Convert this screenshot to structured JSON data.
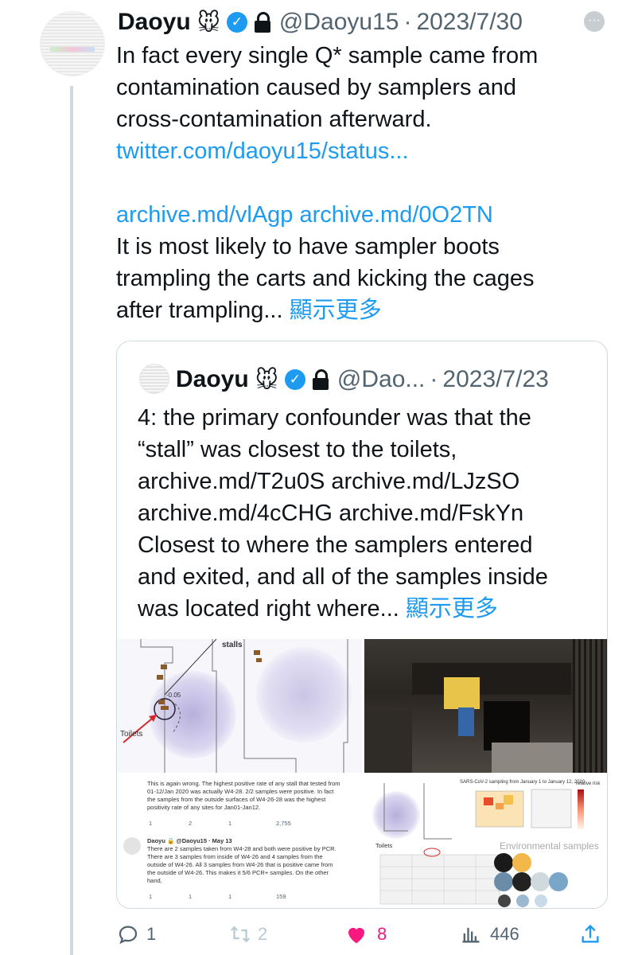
{
  "tweet": {
    "name": "Daoyu",
    "emoji": "🐭",
    "handle": "@Daoyu15",
    "separator": "·",
    "date": "2023/7/30",
    "more_label": "···",
    "lines": [
      "In fact every single Q* sample came from",
      "contamination caused by samplers and",
      "cross-contamination afterward."
    ],
    "link_status": "twitter.com/daoyu15/status...",
    "link_archive_1": "archive.md/vlAgp",
    "link_archive_2": "archive.md/0O2TN",
    "lines2": [
      "It is most likely to have sampler boots",
      "trampling the carts and kicking the cages"
    ],
    "last_line": "after trampling...",
    "show_more": "顯示更多"
  },
  "quote": {
    "name": "Daoyu",
    "emoji": "🐭",
    "handle": "@Dao...",
    "separator": "·",
    "date": "2023/7/23",
    "lines": [
      "4: the primary confounder was that the",
      "“stall” was closest to the toilets,",
      "archive.md/T2u0S archive.md/LJzSO",
      "archive.md/4cCHG archive.md/FskYn",
      "Closest to where the samplers entered",
      "and exited, and all of the samples inside"
    ],
    "last_line": "was located right where...",
    "show_more": "顯示更多",
    "media": {
      "map_label_stalls": "stalls",
      "map_label_toilets": "Toilets",
      "map_label_value": "-0.05",
      "embedded_tweet_text": [
        "This is again wrong. The highest positive rate of any stall that tested from",
        "01-12/Jan 2020 was actually W4-28. 2/2 samples were positive. In fact",
        "the samples from the outside surfaces of W4-26-28 was the highest",
        "positivity rate of any sites for Jan01-Jan12."
      ],
      "embedded_stats_1": [
        "1",
        "2",
        "1",
        "2,755"
      ],
      "embedded_reply_header": "Daoyu 🔒 @Daoyu15 · May 13",
      "embedded_reply_text": [
        "There are 2 samples taken from W4-28 and both were positive by PCR.",
        "There are 3 samples from inside of W4-26 and 4 samples from the",
        "outside of W4-26. All 3 samples from W4-26 that is positive came from",
        "the outside of W4-26. This makes it 5/6 PCR+ samples. On the other",
        "hand,"
      ],
      "embedded_stats_2": [
        "1",
        "1",
        "1",
        "159"
      ],
      "figure_title": "SARS-CoV-2 sampling from January 1 to January 12, 2020",
      "figure_legend_title": "relative risk",
      "figure_toilets": "Toilets",
      "figure_env_label": "Environmental samples"
    }
  },
  "actions": {
    "replies": "1",
    "retweets": "2",
    "likes": "8",
    "views": "446"
  },
  "colors": {
    "link": "#1d9bf0",
    "secondary": "#536471",
    "like": "#f91880",
    "border": "#cfd9de"
  }
}
